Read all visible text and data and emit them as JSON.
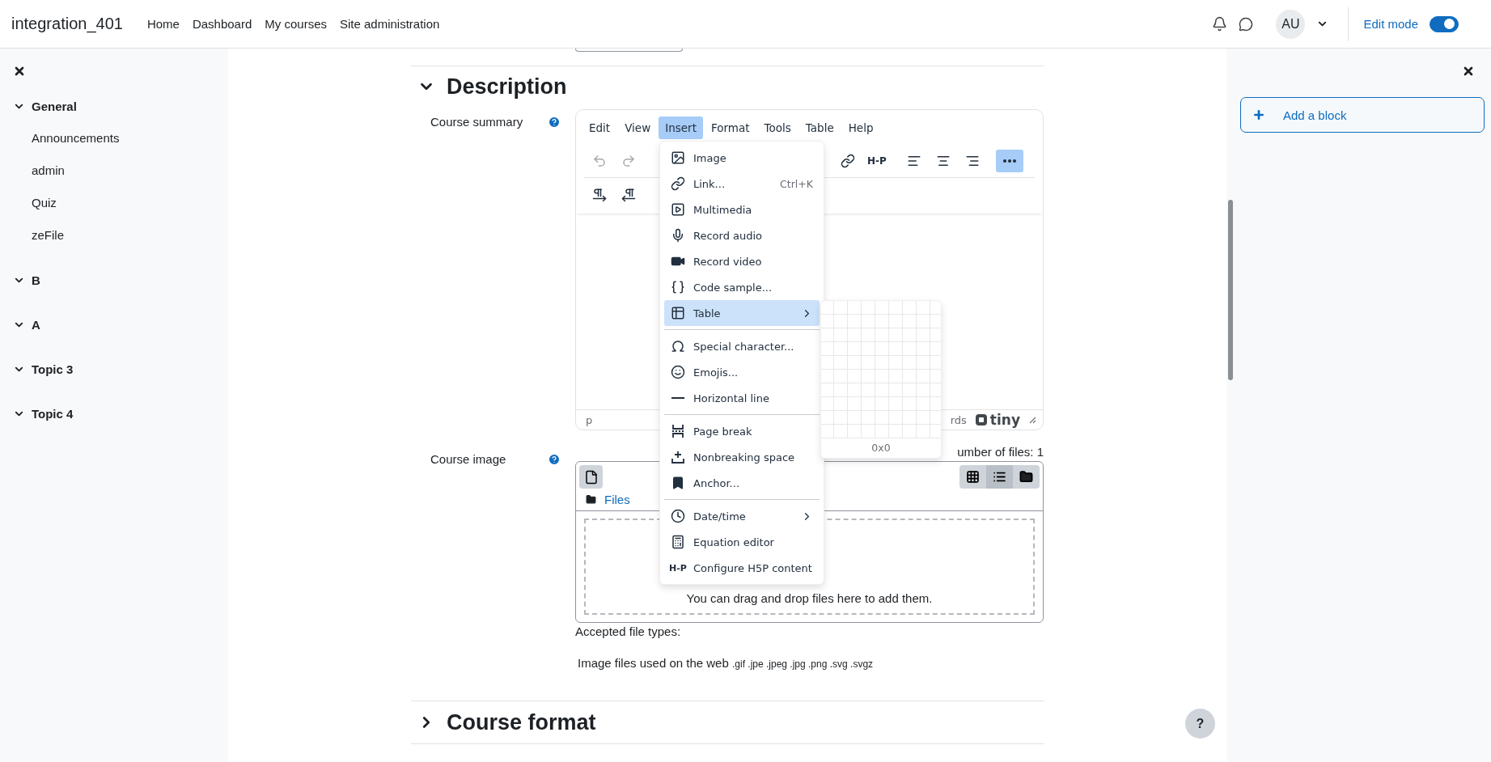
{
  "topbar": {
    "site_name": "integration_401",
    "nav": [
      {
        "label": "Home"
      },
      {
        "label": "Dashboard"
      },
      {
        "label": "My courses"
      },
      {
        "label": "Site administration"
      }
    ],
    "avatar_initials": "AU",
    "edit_mode": {
      "label": "Edit mode",
      "on": true
    }
  },
  "course_index": {
    "items": [
      {
        "label": "General",
        "expanded": true,
        "children": [
          {
            "label": "Announcements"
          },
          {
            "label": "admin"
          },
          {
            "label": "Quiz"
          },
          {
            "label": "zeFile"
          }
        ]
      },
      {
        "label": "B",
        "expanded": true
      },
      {
        "label": "A",
        "expanded": true
      },
      {
        "label": "Topic 3",
        "expanded": true
      },
      {
        "label": "Topic 4",
        "expanded": true
      }
    ]
  },
  "description_section": {
    "title": "Description",
    "expanded": true
  },
  "course_summary": {
    "label": "Course summary",
    "editor": {
      "menubar": [
        {
          "label": "Edit",
          "selected": false
        },
        {
          "label": "View",
          "selected": false
        },
        {
          "label": "Insert",
          "selected": true
        },
        {
          "label": "Format",
          "selected": false
        },
        {
          "label": "Tools",
          "selected": false
        },
        {
          "label": "Table",
          "selected": false
        },
        {
          "label": "Help",
          "selected": false
        }
      ],
      "toolbar_row_1_left": [
        {
          "kind": "undo",
          "disabled": true
        },
        {
          "kind": "redo",
          "disabled": true
        }
      ],
      "toolbar_row_1_right": [
        {
          "kind": "link",
          "disabled": false,
          "selected": false
        },
        {
          "kind": "h5p",
          "label": "H-P",
          "disabled": false,
          "selected": false
        },
        {
          "kind": "align-left",
          "disabled": false,
          "selected": false
        },
        {
          "kind": "align-center",
          "disabled": false,
          "selected": false
        },
        {
          "kind": "align-right",
          "disabled": false,
          "selected": false
        },
        {
          "kind": "more",
          "disabled": false,
          "selected": true
        }
      ],
      "toolbar_row_2": [
        {
          "kind": "ltr",
          "disabled": false
        },
        {
          "kind": "rtl",
          "disabled": false
        }
      ],
      "insert_menu": {
        "groups": [
          [
            {
              "kind": "image",
              "label": "Image",
              "selected": false
            },
            {
              "kind": "link",
              "label": "Link...",
              "shortcut": "Ctrl+K",
              "selected": false
            },
            {
              "kind": "multimedia",
              "label": "Multimedia",
              "selected": false
            },
            {
              "kind": "audio",
              "label": "Record audio",
              "selected": false
            },
            {
              "kind": "video",
              "label": "Record video",
              "selected": false
            },
            {
              "kind": "code",
              "label": "Code sample...",
              "selected": false
            },
            {
              "kind": "table",
              "label": "Table",
              "submenu": true,
              "selected": true
            }
          ],
          [
            {
              "kind": "omega",
              "label": "Special character...",
              "selected": false
            },
            {
              "kind": "emoji",
              "label": "Emojis...",
              "selected": false
            },
            {
              "kind": "hr",
              "label": "Horizontal line",
              "selected": false
            }
          ],
          [
            {
              "kind": "pagebreak",
              "label": "Page break",
              "selected": false
            },
            {
              "kind": "nbsp",
              "label": "Nonbreaking space",
              "selected": false
            },
            {
              "kind": "anchor",
              "label": "Anchor...",
              "selected": false
            }
          ],
          [
            {
              "kind": "clock",
              "label": "Date/time",
              "submenu": true,
              "selected": false
            },
            {
              "kind": "equation",
              "label": "Equation editor",
              "selected": false
            },
            {
              "kind": "h5p",
              "icon_label": "H-P",
              "label": "Configure H5P content",
              "selected": false
            }
          ]
        ]
      },
      "table_picker": {
        "size_label": "0x0"
      },
      "status": {
        "path": "p",
        "word_count": "rds",
        "brand": "tiny"
      }
    }
  },
  "course_image": {
    "label": "Course image",
    "max_files": "umber of files: 1",
    "files_path": "Files",
    "view_modes": [
      {
        "kind": "icons",
        "selected": false
      },
      {
        "kind": "list",
        "selected": true
      },
      {
        "kind": "tree",
        "selected": false
      }
    ],
    "drop_hint": "You can drag and drop files here to add them.",
    "accepted_label": "Accepted file types:",
    "accepted_group": "Image files used on the web",
    "accepted_exts": ".gif .jpe .jpeg .jpg .png .svg .svgz"
  },
  "course_format_section": {
    "title": "Course format",
    "expanded": false
  },
  "blocks_drawer": {
    "add_block": "Add a block"
  },
  "help_button": {
    "label": "?"
  }
}
